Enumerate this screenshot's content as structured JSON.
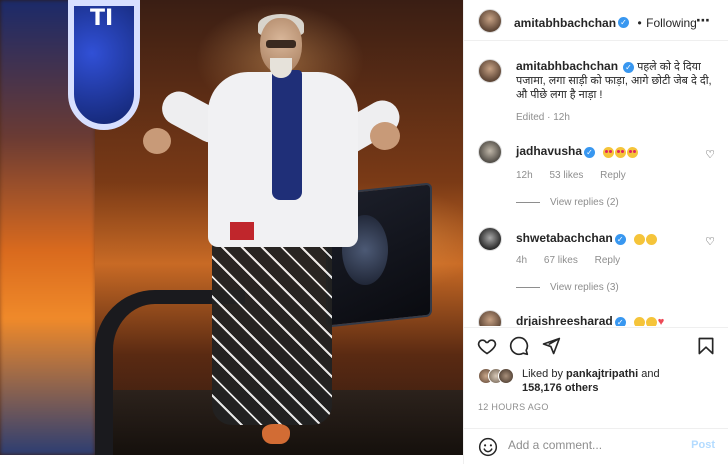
{
  "post": {
    "author": "amitabhbachchan",
    "follow_status": "Following",
    "separator": "•",
    "more_icon": "⋯",
    "caption": "पहले को दे दिया पजामा, लगा साड़ी को फाड़ा, आगे छोटी जेब दे दी, औ पीछे लगा है नाड़ा !",
    "caption_edited": "Edited · 12h",
    "photo_logo_text": "TI"
  },
  "comments": [
    {
      "user": "jadhavusha",
      "verified": true,
      "emojis": [
        "love",
        "love",
        "love"
      ],
      "age": "12h",
      "likes": "53 likes",
      "reply": "Reply",
      "view_replies": "View replies (2)"
    },
    {
      "user": "shwetabachchan",
      "verified": true,
      "emojis": [
        "plain",
        "plain"
      ],
      "age": "4h",
      "likes": "67 likes",
      "reply": "Reply",
      "view_replies": "View replies (3)"
    },
    {
      "user": "drjaishreesharad",
      "verified": true,
      "emojis": [
        "plain",
        "plain",
        "heart"
      ]
    }
  ],
  "likes": {
    "prefix": "Liked by",
    "first_liker": "pankajtripathi",
    "conjunction": "and",
    "others": "158,176 others"
  },
  "timestamp": "12 HOURS AGO",
  "add_comment": {
    "placeholder": "Add a comment...",
    "post_label": "Post"
  },
  "icons": {
    "like": "heart-outline-icon",
    "comment": "comment-bubble-icon",
    "share": "paper-plane-icon",
    "save": "bookmark-icon",
    "emoji": "smiley-icon"
  },
  "colors": {
    "verified_blue": "#3897f0",
    "post_button": "#b3dbff",
    "muted_text": "#8e8e8e"
  }
}
